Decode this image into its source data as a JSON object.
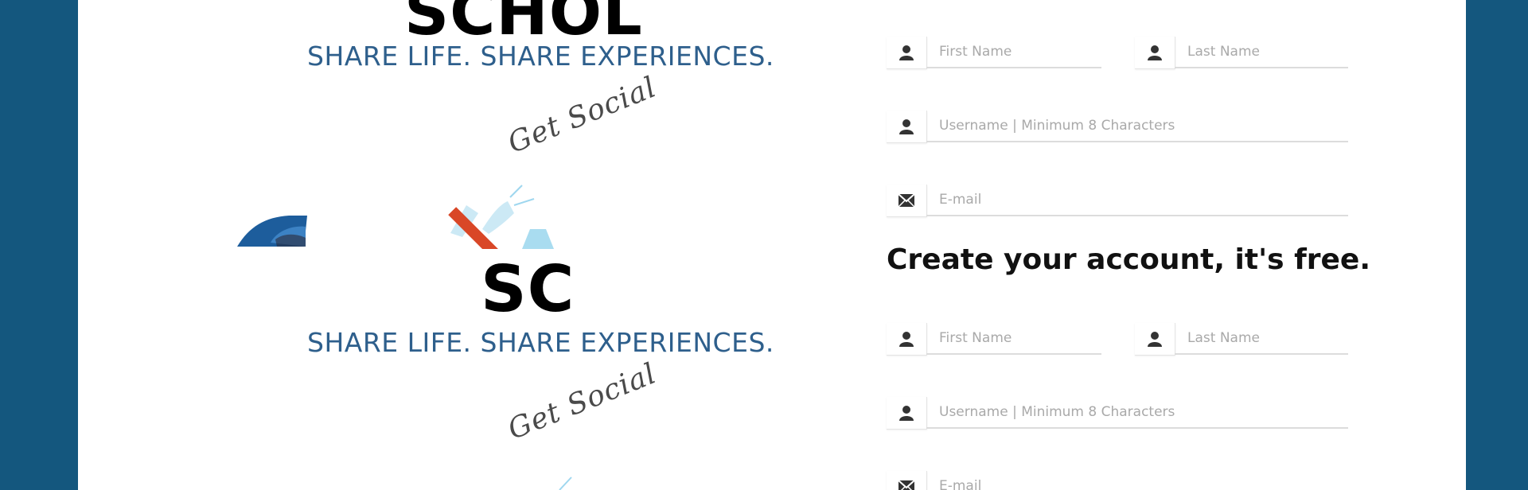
{
  "branding": {
    "logo_top_partial": "SCHOL",
    "logo_mid_partial": "SC",
    "tagline": "SHARE LIFE. SHARE EXPERIENCES.",
    "get_social": "Get Social"
  },
  "form_block_1": {
    "first_name_placeholder": "First Name",
    "last_name_placeholder": "Last Name",
    "username_placeholder": "Username | Minimum 8 Characters",
    "email_placeholder": "E-mail"
  },
  "signup": {
    "title": "Create your account, it's free."
  },
  "form_block_2": {
    "first_name_placeholder": "First Name",
    "last_name_placeholder": "Last Name",
    "username_placeholder": "Username | Minimum 8 Characters",
    "email_placeholder": "E-mail"
  },
  "colors": {
    "background": "#14577e",
    "tagline": "#2e5f8c",
    "panel": "#ffffff"
  }
}
